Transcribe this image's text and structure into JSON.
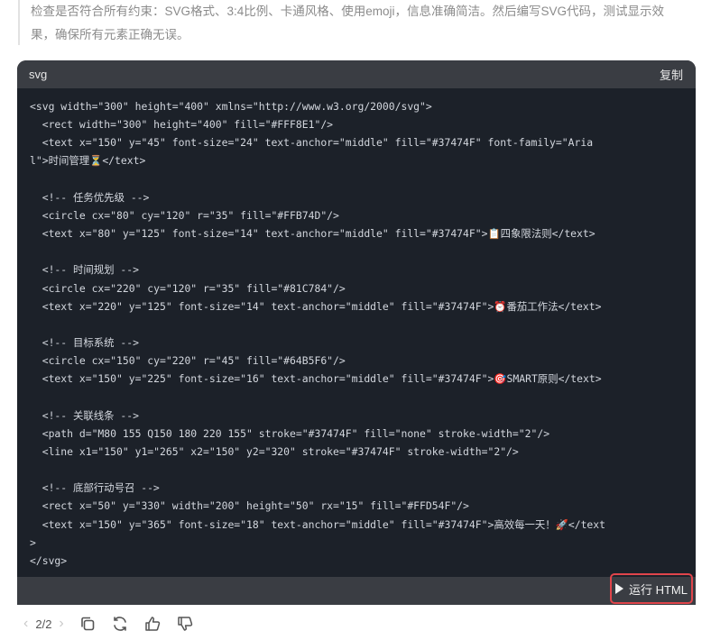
{
  "intro": {
    "line1": "检查是否符合所有约束：SVG格式、3:4比例、卡通风格、使用emoji，信息准确简洁。然后编写SVG代码，测试显示效",
    "line2": "果，确保所有元素正确无误。"
  },
  "code_block": {
    "language": "svg",
    "copy_label": "复制",
    "lines": [
      "<svg width=\"300\" height=\"400\" xmlns=\"http://www.w3.org/2000/svg\">",
      "  <rect width=\"300\" height=\"400\" fill=\"#FFF8E1\"/>",
      "  <text x=\"150\" y=\"45\" font-size=\"24\" text-anchor=\"middle\" fill=\"#37474F\" font-family=\"Aria",
      "l\">时间管理⏳</text>",
      "",
      "  <!-- 任务优先级 -->",
      "  <circle cx=\"80\" cy=\"120\" r=\"35\" fill=\"#FFB74D\"/>",
      "  <text x=\"80\" y=\"125\" font-size=\"14\" text-anchor=\"middle\" fill=\"#37474F\">📋四象限法则</text>",
      "",
      "  <!-- 时间规划 -->",
      "  <circle cx=\"220\" cy=\"120\" r=\"35\" fill=\"#81C784\"/>",
      "  <text x=\"220\" y=\"125\" font-size=\"14\" text-anchor=\"middle\" fill=\"#37474F\">⏰番茄工作法</text>",
      "",
      "  <!-- 目标系统 -->",
      "  <circle cx=\"150\" cy=\"220\" r=\"45\" fill=\"#64B5F6\"/>",
      "  <text x=\"150\" y=\"225\" font-size=\"16\" text-anchor=\"middle\" fill=\"#37474F\">🎯SMART原则</text>",
      "",
      "  <!-- 关联线条 -->",
      "  <path d=\"M80 155 Q150 180 220 155\" stroke=\"#37474F\" fill=\"none\" stroke-width=\"2\"/>",
      "  <line x1=\"150\" y1=\"265\" x2=\"150\" y2=\"320\" stroke=\"#37474F\" stroke-width=\"2\"/>",
      "",
      "  <!-- 底部行动号召 -->",
      "  <rect x=\"50\" y=\"330\" width=\"200\" height=\"50\" rx=\"15\" fill=\"#FFD54F\"/>",
      "  <text x=\"150\" y=\"365\" font-size=\"18\" text-anchor=\"middle\" fill=\"#37474F\">高效每一天！🚀</text",
      ">",
      "</svg>"
    ],
    "run_label": "运行 HTML"
  },
  "pager": {
    "current": "2",
    "separator": "/",
    "total": "2"
  },
  "icons": {
    "copy": "copy-icon",
    "regenerate": "refresh-icon",
    "like": "thumbs-up-icon",
    "dislike": "thumbs-down-icon"
  }
}
